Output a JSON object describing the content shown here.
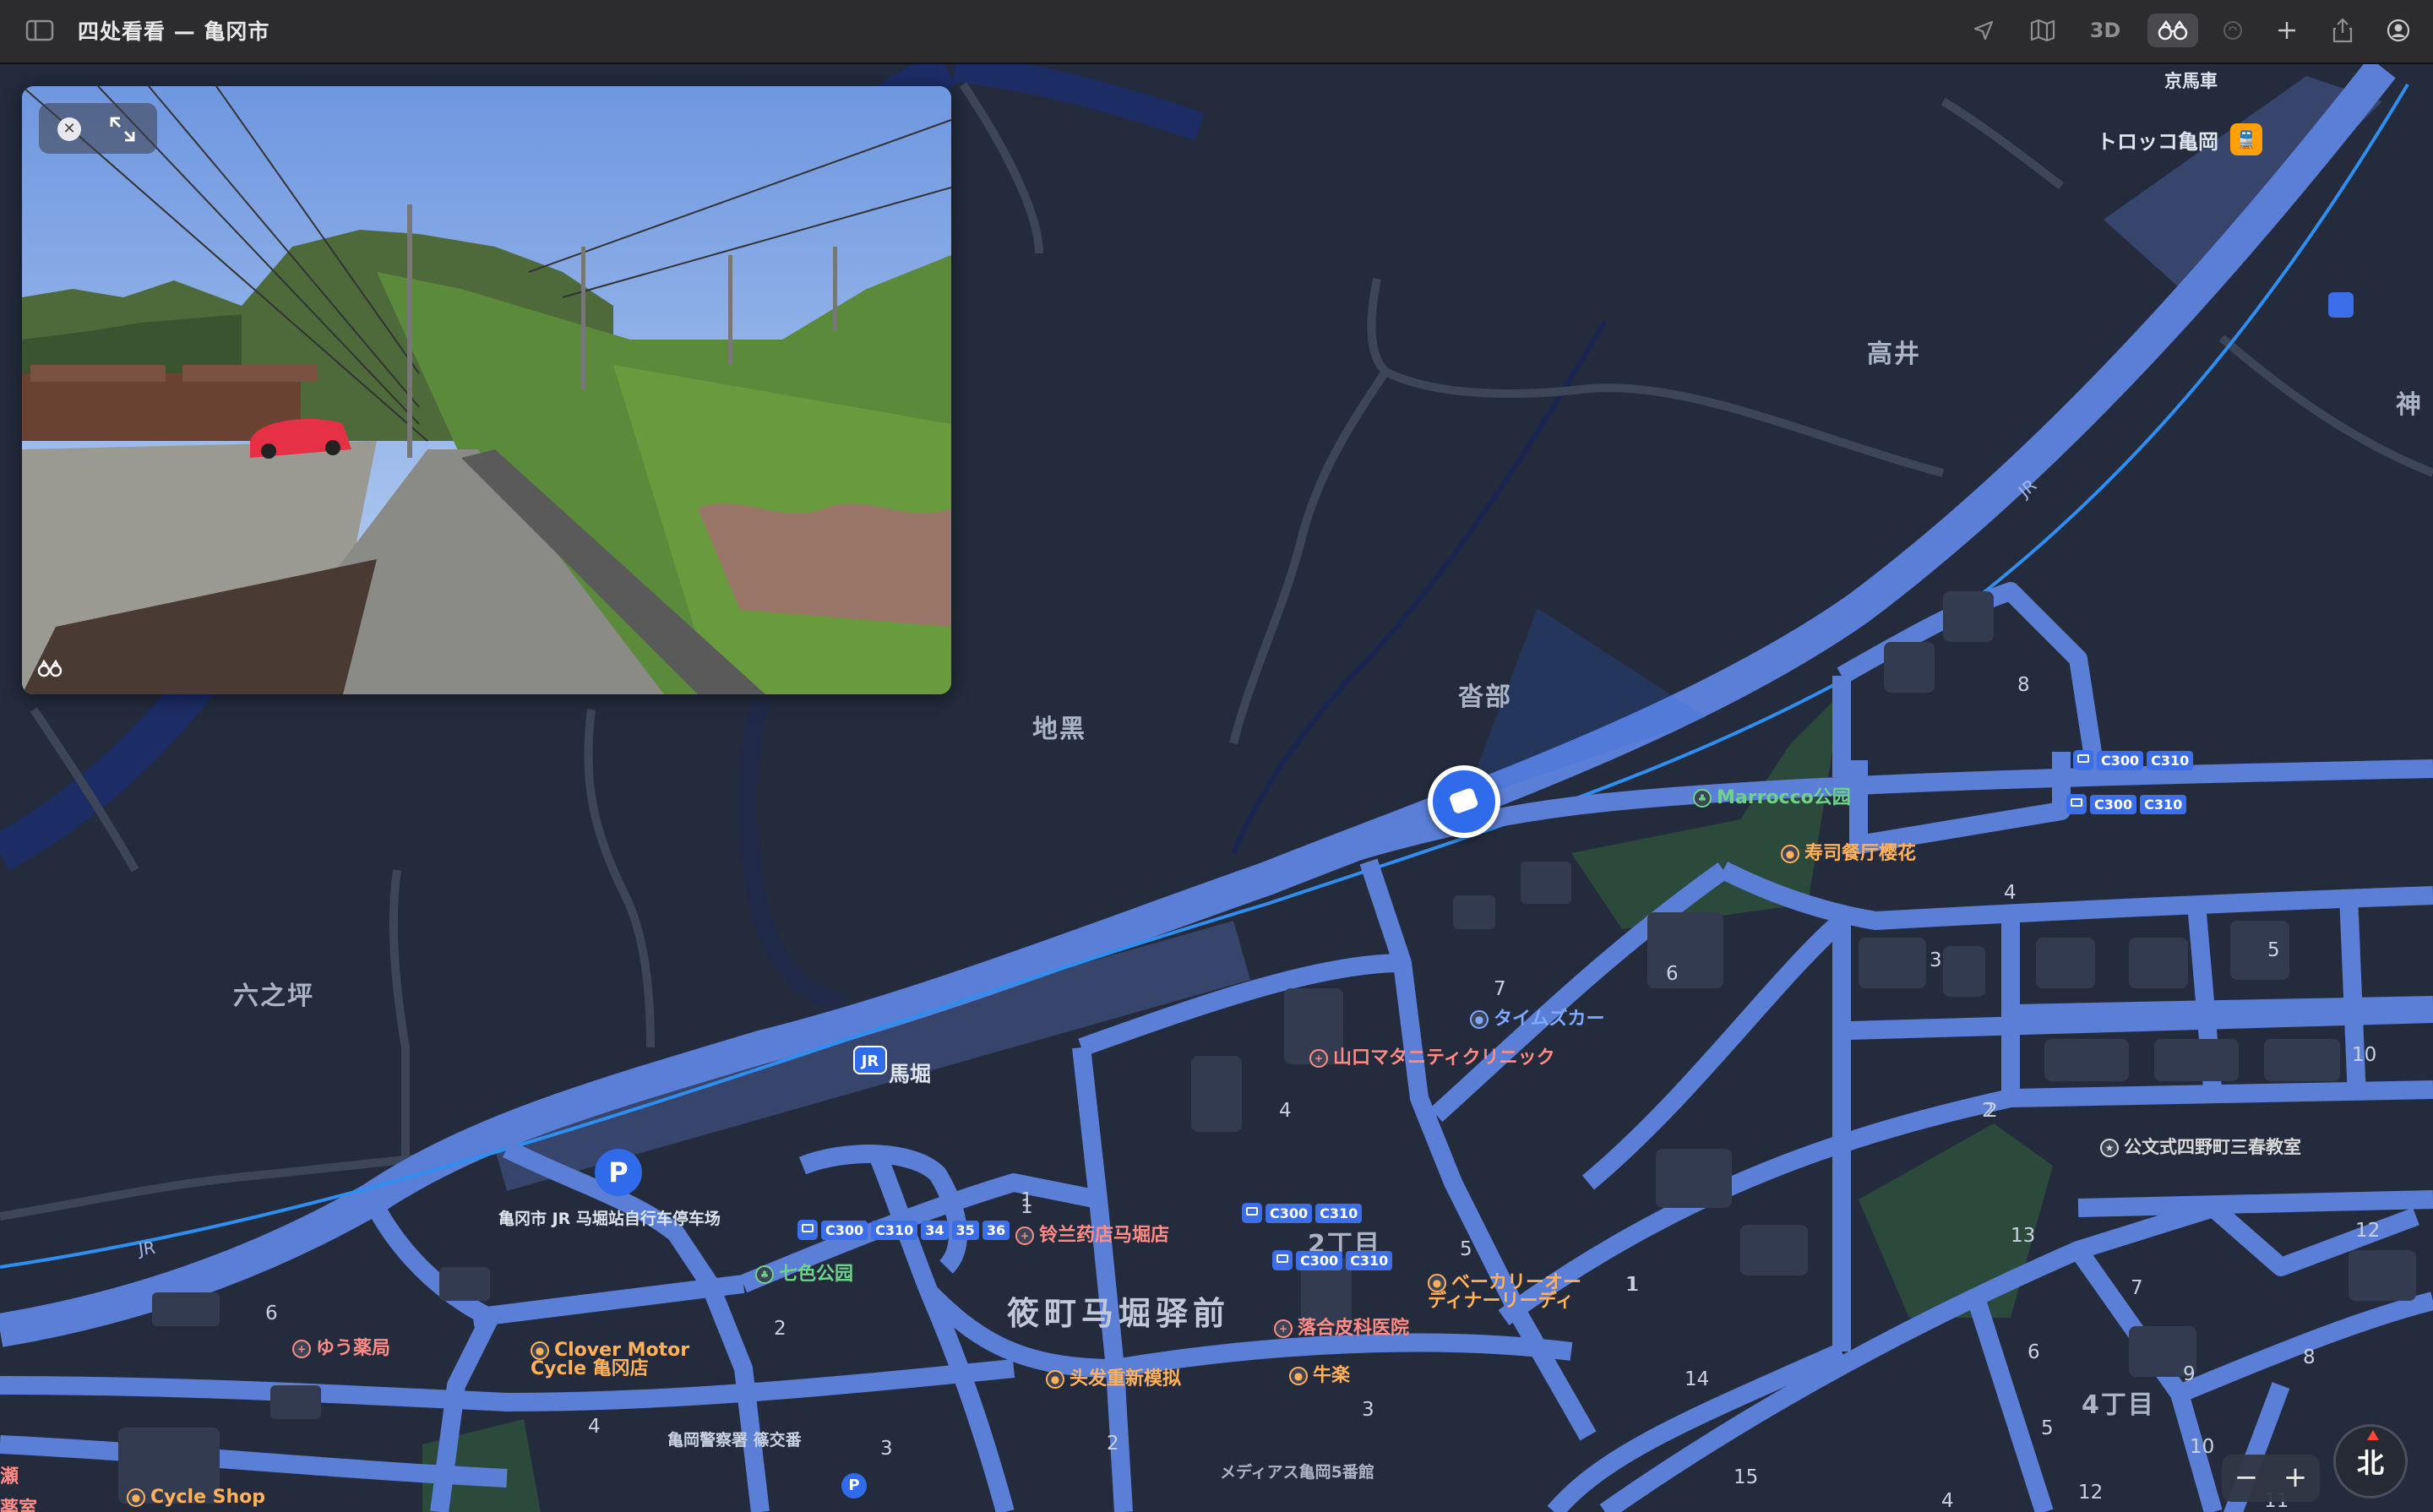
{
  "window": {
    "title": "四处看看 — 亀冈市"
  },
  "toolbar": {
    "buttons": [
      {
        "name": "location-arrow-icon"
      },
      {
        "name": "map-mode-icon"
      },
      {
        "name": "3d-toggle",
        "label": "3D"
      },
      {
        "name": "look-around-icon",
        "active": true
      },
      {
        "name": "traffic-icon"
      },
      {
        "name": "add-icon"
      },
      {
        "name": "share-icon"
      },
      {
        "name": "account-icon"
      }
    ]
  },
  "look_around": {
    "close_icon": "close-icon",
    "expand_icon": "expand-icon",
    "binoculars_icon": "binoculars-icon"
  },
  "map": {
    "areas": {
      "takai": "高井",
      "jiguro": "地黑",
      "kanabe": "沓部",
      "rokunotsubo": "六之坪",
      "shinotsu": "筱町马堀驿前",
      "chome2": "2丁目",
      "chome4": "4丁目",
      "kami": "神"
    },
    "stations": {
      "umahori_jr_label": "JR",
      "umahori": "馬堀",
      "torokko": "トロッコ亀岡",
      "keibasha": "京馬車",
      "parking_label": "P",
      "parking": "亀冈市 JR 马堀站自行车停车场",
      "jr_track_1": "JR",
      "jr_track_2": "JR"
    },
    "pois": {
      "marrocco": "Marrocco公园",
      "sushi": "寿司餐厅樱花",
      "times": "タイムズカー",
      "yamaguchi": "山口マタニティクリニック",
      "kumon": "公文式四野町三春教室",
      "suzuran": "铃兰药店马堀店",
      "nanairo": "七色公园",
      "bakery": "ベーカリーオー\nディナーリーディ",
      "ochiai": "落合皮科医院",
      "gyuraku": "牛楽",
      "hair": "头发重新模拟",
      "yuu": "ゆう薬局",
      "clover": "Clover Motor\nCycle 亀冈店",
      "police": "亀岡警察署 篠交番",
      "medias": "メディアス亀岡5番館",
      "cycle_shop": "Cycle Shop",
      "left_edge_1": "瀬",
      "left_edge_2": "薬室"
    },
    "bus_stops": [
      {
        "tags": [
          "C300",
          "C310"
        ]
      },
      {
        "tags": [
          "C300",
          "C310"
        ]
      },
      {
        "tags": [
          "C300",
          "C310"
        ]
      },
      {
        "tags": [
          "C300",
          "C310"
        ]
      },
      {
        "tags": [
          "C300",
          "C310",
          "34",
          "35",
          "36"
        ]
      }
    ],
    "block_numbers": [
      "8",
      "4",
      "3",
      "5",
      "6",
      "7",
      "4",
      "2",
      "1",
      "10",
      "13",
      "12",
      "7",
      "6",
      "9",
      "8",
      "5",
      "10",
      "12",
      "11",
      "14",
      "15",
      "4",
      "5",
      "1",
      "2",
      "3",
      "1",
      "2",
      "6",
      "4",
      "3",
      "2",
      "1"
    ]
  },
  "controls": {
    "zoom_out": "−",
    "zoom_in": "+",
    "compass": "北"
  },
  "colors": {
    "map_bg": "#232b3d",
    "road": "#5b7ed6",
    "road_dark": "#3a4a72",
    "railway": "#2e8ff0",
    "water": "#1d2f66",
    "green": "#2c4a3c",
    "accent": "#2f6bea"
  }
}
